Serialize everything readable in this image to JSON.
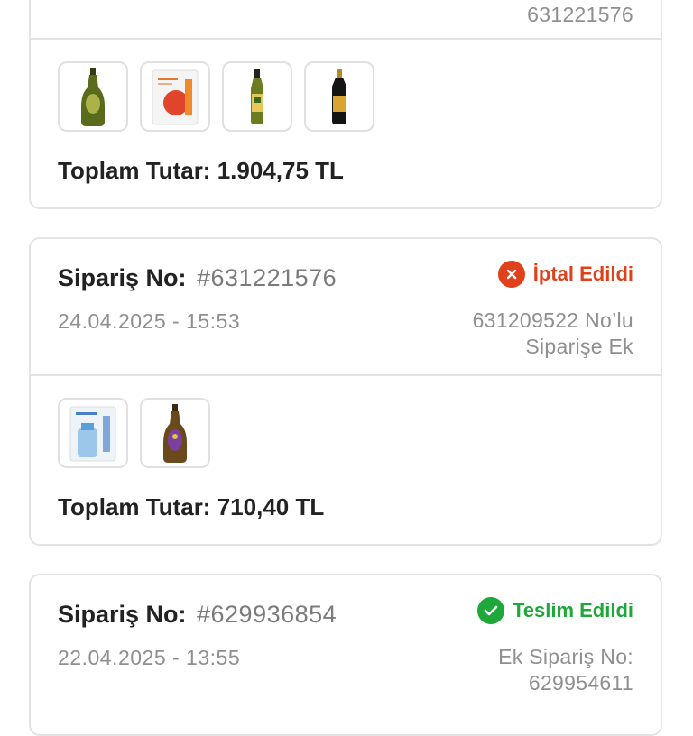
{
  "orders": [
    {
      "order_label": "",
      "order_number": "",
      "date": "",
      "right_note": "631221576",
      "status": null,
      "products": [
        "olive-oil-bottle-icon",
        "shopping-bag-icon",
        "olive-oil-bottle-icon",
        "olive-oil-bottle-icon"
      ],
      "total_label": "Toplam Tutar:",
      "total_value": "1.904,75 TL"
    },
    {
      "order_label": "Sipariş No:",
      "order_number": "#631221576",
      "date": "24.04.2025 - 15:53",
      "right_note_line1": "631209522 No’lu",
      "right_note_line2": "Siparişe Ek",
      "status": {
        "label": "İptal Edildi",
        "color": "#e0401a",
        "icon": "cancel-circle-icon"
      },
      "products": [
        "shopping-bag-icon",
        "olive-oil-bottle-icon"
      ],
      "total_label": "Toplam Tutar:",
      "total_value": "710,40 TL"
    },
    {
      "order_label": "Sipariş No:",
      "order_number": "#629936854",
      "date": "22.04.2025 - 13:55",
      "right_note_line1": "Ek Sipariş No:",
      "right_note_line2": "629954611",
      "status": {
        "label": "Teslim Edildi",
        "color": "#1fa83a",
        "icon": "check-circle-icon"
      }
    }
  ]
}
